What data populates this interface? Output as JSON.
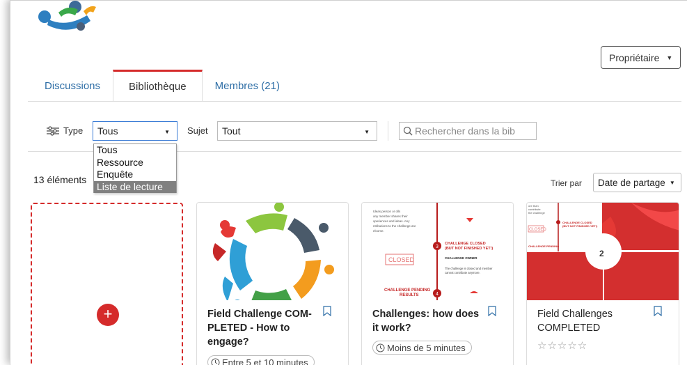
{
  "header": {
    "owner_button": "Propriétaire"
  },
  "tabs": [
    {
      "label": "Discussions"
    },
    {
      "label": "Bibliothèque"
    },
    {
      "label": "Membres (21)"
    }
  ],
  "filters": {
    "type_label": "Type",
    "type_value": "Tous",
    "type_options": [
      "Tous",
      "Ressource",
      "Enquête",
      "Liste de lecture"
    ],
    "highlighted_option": "Liste de lecture",
    "subject_label": "Sujet",
    "subject_value": "Tout",
    "search_placeholder": "Rechercher dans la bib"
  },
  "results": {
    "count": "13 éléments",
    "sort_label": "Trier par",
    "sort_value": "Date de partage"
  },
  "cards": [
    {
      "title": "Field Challenge COM-PLETED - How to engage?",
      "duration": "Entre 5 et 10 minutes"
    },
    {
      "title": "Challenges: how does it work?",
      "duration": "Moins de 5 minutes",
      "thumb_text": {
        "intro": [
          "Ideas person or olls",
          "any member shares their",
          "xperiences and ideas. Any",
          "ntributions to the challenge are",
          "elcome."
        ],
        "step_3_title": "CHALLENGE CLOSED",
        "step_3_sub": "(BUT NOT FINISHED YET!)",
        "step_3_owner": "CHALLENGE OWNER",
        "step_3_desc": [
          "The challenge is closed and member",
          "cannot contribute anymore."
        ],
        "stamp": "CLOSED",
        "step_4_title": "CHALLENGE PENDING",
        "step_4_sub": "RESULTS",
        "step_3_num": "3",
        "step_4_num": "4"
      }
    },
    {
      "title": "Field Challenges COMPLETED",
      "stars": "☆☆☆☆☆",
      "thumb_text": {
        "intro": [
          "ore than",
          "contribute",
          "the challenge"
        ],
        "closed_title": "CHALLENGE CLOSED",
        "closed_sub": "(BUT NOT FINISHED YET!)",
        "stamp": "CLOSED",
        "pending": "CHALLENGE PENDING",
        "number": "2"
      }
    }
  ],
  "colors": {
    "accent": "#d52b2b",
    "link": "#2e6ea6",
    "focus": "#3a7bd5"
  }
}
